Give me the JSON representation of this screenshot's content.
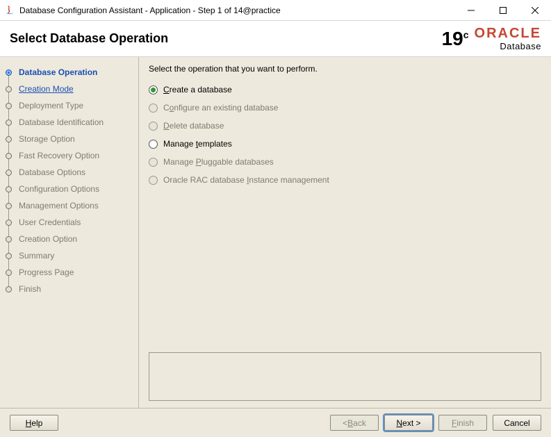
{
  "window": {
    "title": "Database Configuration Assistant - Application - Step 1 of 14@practice"
  },
  "header": {
    "title": "Select Database Operation",
    "brand_version": "19",
    "brand_sup": "c",
    "brand_name": "ORACLE",
    "brand_sub": "Database"
  },
  "sidebar": {
    "steps": [
      {
        "label": "Database Operation",
        "state": "active"
      },
      {
        "label": "Creation Mode",
        "state": "next"
      },
      {
        "label": "Deployment Type",
        "state": "disabled"
      },
      {
        "label": "Database Identification",
        "state": "disabled"
      },
      {
        "label": "Storage Option",
        "state": "disabled"
      },
      {
        "label": "Fast Recovery Option",
        "state": "disabled"
      },
      {
        "label": "Database Options",
        "state": "disabled"
      },
      {
        "label": "Configuration Options",
        "state": "disabled"
      },
      {
        "label": "Management Options",
        "state": "disabled"
      },
      {
        "label": "User Credentials",
        "state": "disabled"
      },
      {
        "label": "Creation Option",
        "state": "disabled"
      },
      {
        "label": "Summary",
        "state": "disabled"
      },
      {
        "label": "Progress Page",
        "state": "disabled"
      },
      {
        "label": "Finish",
        "state": "disabled"
      }
    ]
  },
  "main": {
    "instruction": "Select the operation that you want to perform.",
    "options": [
      {
        "pre": "",
        "mn": "C",
        "post": "reate a database",
        "selected": true,
        "enabled": true
      },
      {
        "pre": "C",
        "mn": "o",
        "post": "nfigure an existing database",
        "selected": false,
        "enabled": false
      },
      {
        "pre": "",
        "mn": "D",
        "post": "elete database",
        "selected": false,
        "enabled": false
      },
      {
        "pre": "Manage ",
        "mn": "t",
        "post": "emplates",
        "selected": false,
        "enabled": true
      },
      {
        "pre": "Manage ",
        "mn": "P",
        "post": "luggable databases",
        "selected": false,
        "enabled": false
      },
      {
        "pre": "Oracle RAC database ",
        "mn": "I",
        "post": "nstance management",
        "selected": false,
        "enabled": false
      }
    ]
  },
  "footer": {
    "help_mn": "H",
    "help_post": "elp",
    "back_pre": "< ",
    "back_mn": "B",
    "back_post": "ack",
    "next_mn": "N",
    "next_post": "ext >",
    "finish_mn": "F",
    "finish_post": "inish",
    "cancel": "Cancel"
  }
}
